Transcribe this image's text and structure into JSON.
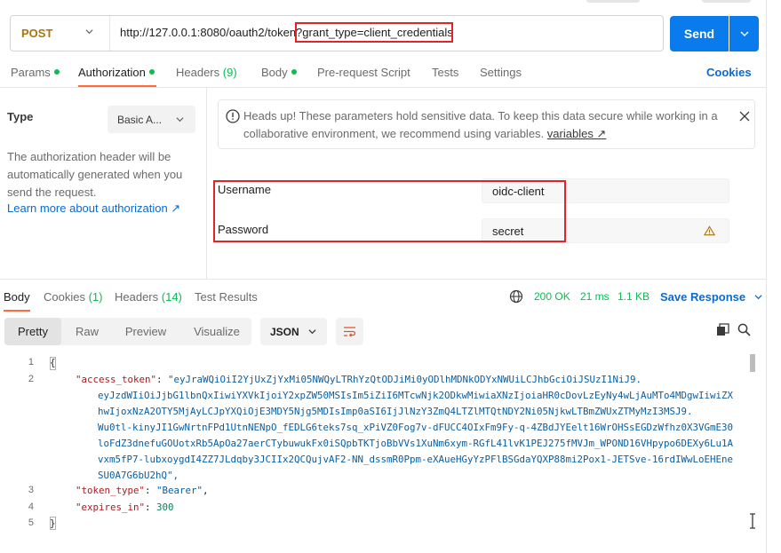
{
  "request": {
    "method": "POST",
    "url": "http://127.0.0.1:8080/oauth2/token?grant_type=client_credentials",
    "url_base": "http://127.0.0.1:8080/oauth2/token?",
    "url_param": "grant_type=client_credentials",
    "send_label": "Send"
  },
  "tabs": {
    "params": "Params",
    "authorization": "Authorization",
    "headers": "Headers",
    "headers_count": "(9)",
    "body": "Body",
    "prerequest": "Pre-request Script",
    "tests": "Tests",
    "settings": "Settings",
    "cookies": "Cookies"
  },
  "auth": {
    "type_label": "Type",
    "type_value": "Basic A...",
    "description": "The authorization header will be automatically generated when you send the request.",
    "learn_more": "Learn more about authorization ↗",
    "warning_text": "Heads up! These parameters hold sensitive data. To keep this data secure while working in a collaborative environment, we recommend using variables.",
    "warning_link": "variables ↗",
    "username_label": "Username",
    "username_value": "oidc-client",
    "password_label": "Password",
    "password_value": "secret"
  },
  "response": {
    "tabs": {
      "body": "Body",
      "cookies": "Cookies",
      "cookies_count": "(1)",
      "headers": "Headers",
      "headers_count": "(14)",
      "test_results": "Test Results"
    },
    "status": "200 OK",
    "time": "21 ms",
    "size": "1.1 KB",
    "save_label": "Save Response",
    "views": {
      "pretty": "Pretty",
      "raw": "Raw",
      "preview": "Preview",
      "visualize": "Visualize"
    },
    "format": "JSON",
    "line_numbers": [
      "1",
      "2",
      "3",
      "4",
      "5"
    ],
    "json": {
      "open": "{",
      "close": "}",
      "access_token_key": "\"access_token\"",
      "access_token_lines": [
        "\"eyJraWQiOiI2YjUxZjYxMi05NWQyLTRhYzQtODJiMi0yODlhMDNkODYxNWUiLCJhbGciOiJSUzI1NiJ9.",
        "eyJzdWIiOiJjbG1lbnQxIiwiYXVkIjoiY2xpZW50MSIsIm5iZiI6MTcwNjk2ODkwMiwiaXNzIjoiaHR0cDovLzEyNy4wLjAuMTo4MDgwIiwiZX",
        "hwIjoxNzA2OTY5MjAyLCJpYXQiOjE3MDY5Njg5MDIsImp0aSI6IjJlNzY3ZmQ4LTZlMTQtNDY2Ni05NjkwLTBmZWUxZTMyMzI3MSJ9.",
        "Wu0tl-kinyJI1GwNrtnFPd1UtnNENpO_fEDLG6teks7sq_xPiVZ0Fog7v-dFUCC4OIxFm9Fy-q-4ZBdJYEelt16WrOHSsEGDzWfhz0X3VGmE30",
        "loFdZ3dnefuGOUotxRb5ApOa27aerCTybuwukFx0iSQpbTKTjoBbVVs1XuNm6xym-RGfL41lvK1PEJ275fMVJm_WPOND16VHpypo6DEXy6Lu1A",
        "vxm5fP7-lubxoygdI4ZZ7JLdqby3JCIIx2QCQujvAF2-NN_dssmR0Ppm-eXAueHGyYzPFlBSGdaYQXP88mi2Pox1-JETSve-16rdIWwLoEHEne",
        "SU0A7G6bU2hQ\","
      ],
      "token_type_key": "\"token_type\"",
      "token_type_value": "\"Bearer\"",
      "expires_in_key": "\"expires_in\"",
      "expires_in_value": "300"
    }
  },
  "colors": {
    "accent_orange": "#ff6c37",
    "send_blue": "#097bed",
    "link_blue": "#0b6acf",
    "status_green": "#0cbb52",
    "highlight_red": "#e0242b"
  }
}
